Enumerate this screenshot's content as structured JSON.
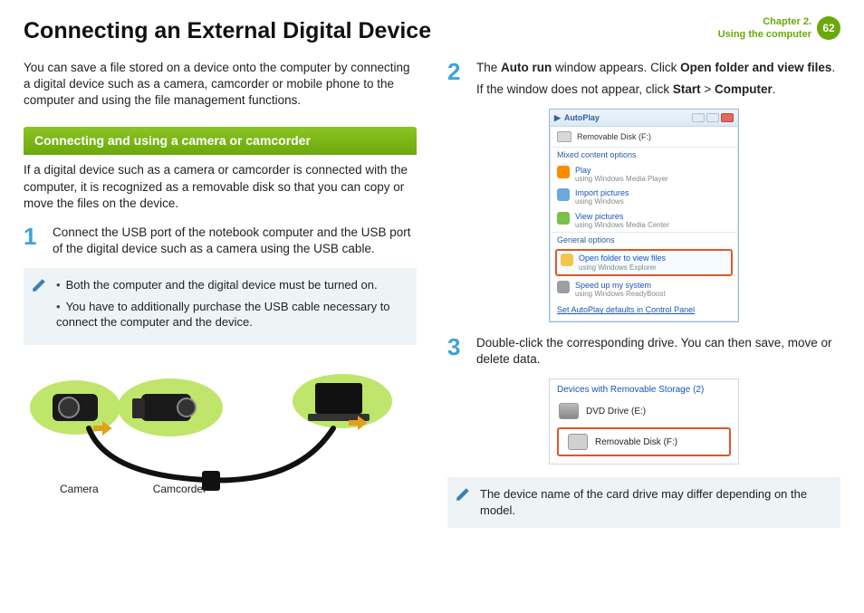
{
  "header": {
    "title": "Connecting an External Digital Device",
    "chapter_line1": "Chapter 2.",
    "chapter_line2": "Using the computer",
    "page": "62"
  },
  "left": {
    "intro": "You can save a file stored on a device onto the computer by connecting a digital device such as a camera, camcorder or mobile phone to the computer and using the file management functions.",
    "section_title": "Connecting and using a camera or camcorder",
    "section_desc": "If a digital device such as a camera or camcorder is connected with the computer, it is recognized as a removable disk so that you can copy or move the files on the device.",
    "step1_num": "1",
    "step1_text": "Connect the USB port of the notebook computer and the USB port of the digital device such as a camera using the USB cable.",
    "note1": "Both the computer and the digital device must be turned on.",
    "note2": "You have to additionally purchase the USB cable necessary to connect the computer and the device.",
    "label_camera": "Camera",
    "label_camcorder": "Camcorder"
  },
  "right": {
    "step2_num": "2",
    "step2_pre": "The ",
    "step2_b1": "Auto run",
    "step2_mid": " window appears. Click ",
    "step2_b2": "Open folder and view files",
    "step2_end": ".",
    "step2_line2_a": "If the window does not appear, click ",
    "step2_line2_b1": "Start",
    "step2_line2_gt": " > ",
    "step2_line2_b2": "Computer",
    "step2_line2_end": ".",
    "autoplay": {
      "title": "AutoPlay",
      "drive": "Removable Disk (F:)",
      "section_mixed": "Mixed content options",
      "item_play": "Play",
      "item_play_sub": "using Windows Media Player",
      "item_import": "Import pictures",
      "item_import_sub": "using Windows",
      "item_view": "View pictures",
      "item_view_sub": "using Windows Media Center",
      "section_general": "General options",
      "item_open": "Open folder to view files",
      "item_open_sub": "using Windows Explorer",
      "item_speed": "Speed up my system",
      "item_speed_sub": "using Windows ReadyBoost",
      "link": "Set AutoPlay defaults in Control Panel"
    },
    "step3_num": "3",
    "step3_text": "Double-click the corresponding drive. You can then save, move or delete data.",
    "storage": {
      "header": "Devices with Removable Storage (2)",
      "dvd": "DVD Drive (E:)",
      "removable": "Removable Disk (F:)"
    },
    "note_bottom": "The device name of the card drive may differ depending on the model."
  }
}
